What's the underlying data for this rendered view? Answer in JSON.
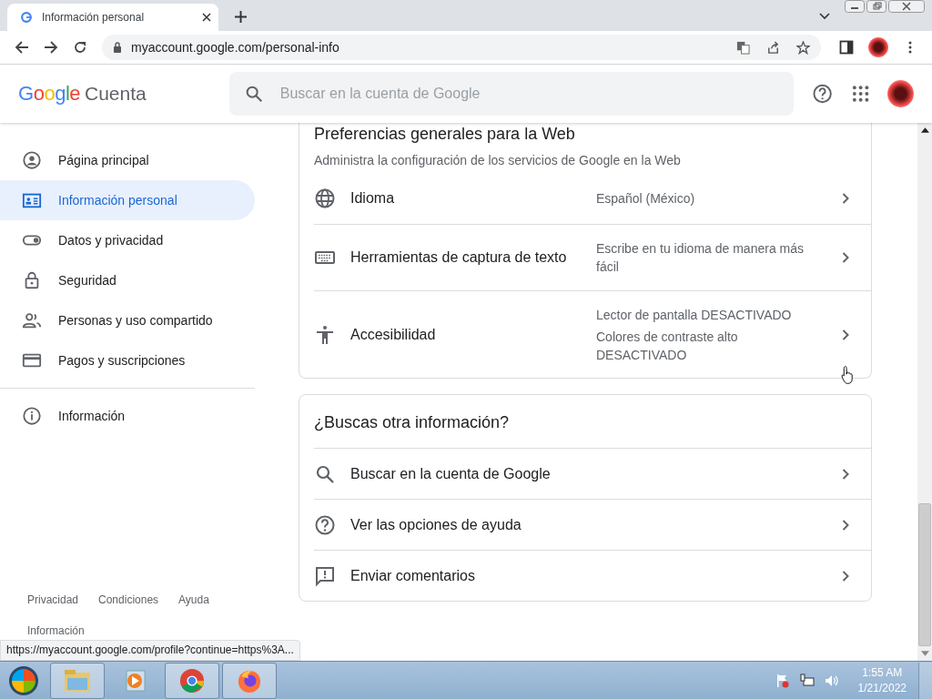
{
  "browser": {
    "tab": {
      "title": "Información personal",
      "selected": true
    },
    "address": "myaccount.google.com/personal-info",
    "status_url": "https://myaccount.google.com/profile?continue=https%3A..."
  },
  "header": {
    "logo": "Google",
    "product": "Cuenta",
    "search": {
      "placeholder": "Buscar en la cuenta de Google"
    }
  },
  "sidebar": {
    "items": [
      {
        "label": "Página principal",
        "selected": false
      },
      {
        "label": "Información personal",
        "selected": true
      },
      {
        "label": "Datos y privacidad",
        "selected": false
      },
      {
        "label": "Seguridad",
        "selected": false
      },
      {
        "label": "Personas y uso compartido",
        "selected": false
      },
      {
        "label": "Pagos y suscripciones",
        "selected": false
      }
    ],
    "after_divider": [
      {
        "label": "Información",
        "selected": false
      }
    ],
    "footer_links": [
      "Privacidad",
      "Condiciones",
      "Ayuda"
    ],
    "footer_more": "Información"
  },
  "preferences": {
    "title": "Preferencias generales para la Web",
    "subtitle": "Administra la configuración de los servicios de Google en la Web",
    "rows": [
      {
        "label": "Idioma",
        "values": [
          "Español (México)"
        ]
      },
      {
        "label": "Herramientas de captura de texto",
        "values": [
          "Escribe en tu idioma de manera más fácil"
        ]
      },
      {
        "label": "Accesibilidad",
        "values": [
          "Lector de pantalla DESACTIVADO",
          "Colores de contraste alto DESACTIVADO"
        ]
      }
    ]
  },
  "more_info": {
    "title": "¿Buscas otra información?",
    "rows": [
      {
        "label": "Buscar en la cuenta de Google"
      },
      {
        "label": "Ver las opciones de ayuda"
      },
      {
        "label": "Enviar comentarios"
      }
    ]
  },
  "taskbar": {
    "time": "1:55 AM",
    "date": "1/21/2022"
  }
}
